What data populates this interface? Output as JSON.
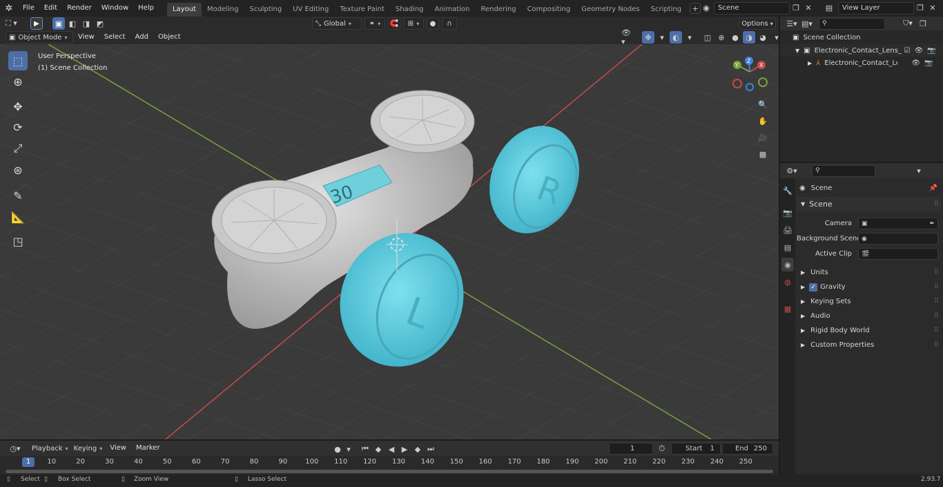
{
  "topbar": {
    "menus": [
      "File",
      "Edit",
      "Render",
      "Window",
      "Help"
    ],
    "workspaces": [
      "Layout",
      "Modeling",
      "Sculpting",
      "UV Editing",
      "Texture Paint",
      "Shading",
      "Animation",
      "Rendering",
      "Compositing",
      "Geometry Nodes",
      "Scripting"
    ],
    "active_workspace": "Layout",
    "scene_name": "Scene",
    "view_layer": "View Layer"
  },
  "viewport_header": {
    "mode": "Object Mode",
    "menus": [
      "View",
      "Select",
      "Add",
      "Object"
    ],
    "transform_orientation": "Global",
    "options_label": "Options"
  },
  "viewport": {
    "perspective_label": "User Perspective",
    "collection_label": "(1) Scene Collection",
    "lcd_text": "30"
  },
  "outliner": {
    "search_placeholder": "",
    "root": "Scene Collection",
    "items": [
      {
        "label": "Electronic_Contact_Lens_Case"
      },
      {
        "label": "Electronic_Contact_Lens_"
      }
    ]
  },
  "properties": {
    "context_title": "Scene",
    "panel_title": "Scene",
    "fields": [
      {
        "label": "Camera",
        "value": ""
      },
      {
        "label": "Background Scene",
        "value": ""
      },
      {
        "label": "Active Clip",
        "value": ""
      }
    ],
    "sections": [
      "Units",
      "Gravity",
      "Keying Sets",
      "Audio",
      "Rigid Body World",
      "Custom Properties"
    ]
  },
  "timeline": {
    "menus": [
      "Playback",
      "Keying",
      "View",
      "Marker"
    ],
    "current_frame": "1",
    "start_label": "Start",
    "start_value": "1",
    "end_label": "End",
    "end_value": "250",
    "ruler": [
      "1",
      "10",
      "20",
      "30",
      "40",
      "50",
      "60",
      "70",
      "80",
      "90",
      "100",
      "110",
      "120",
      "130",
      "140",
      "150",
      "160",
      "170",
      "180",
      "190",
      "200",
      "210",
      "220",
      "230",
      "240",
      "250"
    ]
  },
  "statusbar": {
    "select": "Select",
    "box_select": "Box Select",
    "zoom_view": "Zoom View",
    "lasso_select": "Lasso Select",
    "version": "2.93.7"
  },
  "colors": {
    "accent": "#4d6fa8",
    "x_axis": "#c84a4a",
    "y_axis": "#7aa33a",
    "z_axis": "#3f84d8",
    "lens_cap": "#5cc8dc"
  }
}
